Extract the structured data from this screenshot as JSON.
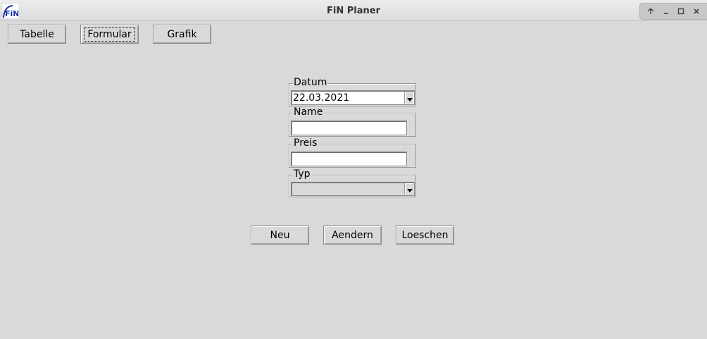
{
  "window": {
    "title": "FiN Planer",
    "app_icon_text": "FiN"
  },
  "toolbar": {
    "tabelle_label": "Tabelle",
    "formular_label": "Formular",
    "grafik_label": "Grafik"
  },
  "form": {
    "datum": {
      "label": "Datum",
      "value": "22.03.2021"
    },
    "name": {
      "label": "Name",
      "value": ""
    },
    "preis": {
      "label": "Preis",
      "value": ""
    },
    "typ": {
      "label": "Typ",
      "value": ""
    }
  },
  "actions": {
    "neu_label": "Neu",
    "aendern_label": "Aendern",
    "loeschen_label": "Loeschen"
  },
  "colors": {
    "background": "#d9d9d9",
    "entry_background": "#ffffff",
    "icon_blue": "#1a2fa8"
  }
}
